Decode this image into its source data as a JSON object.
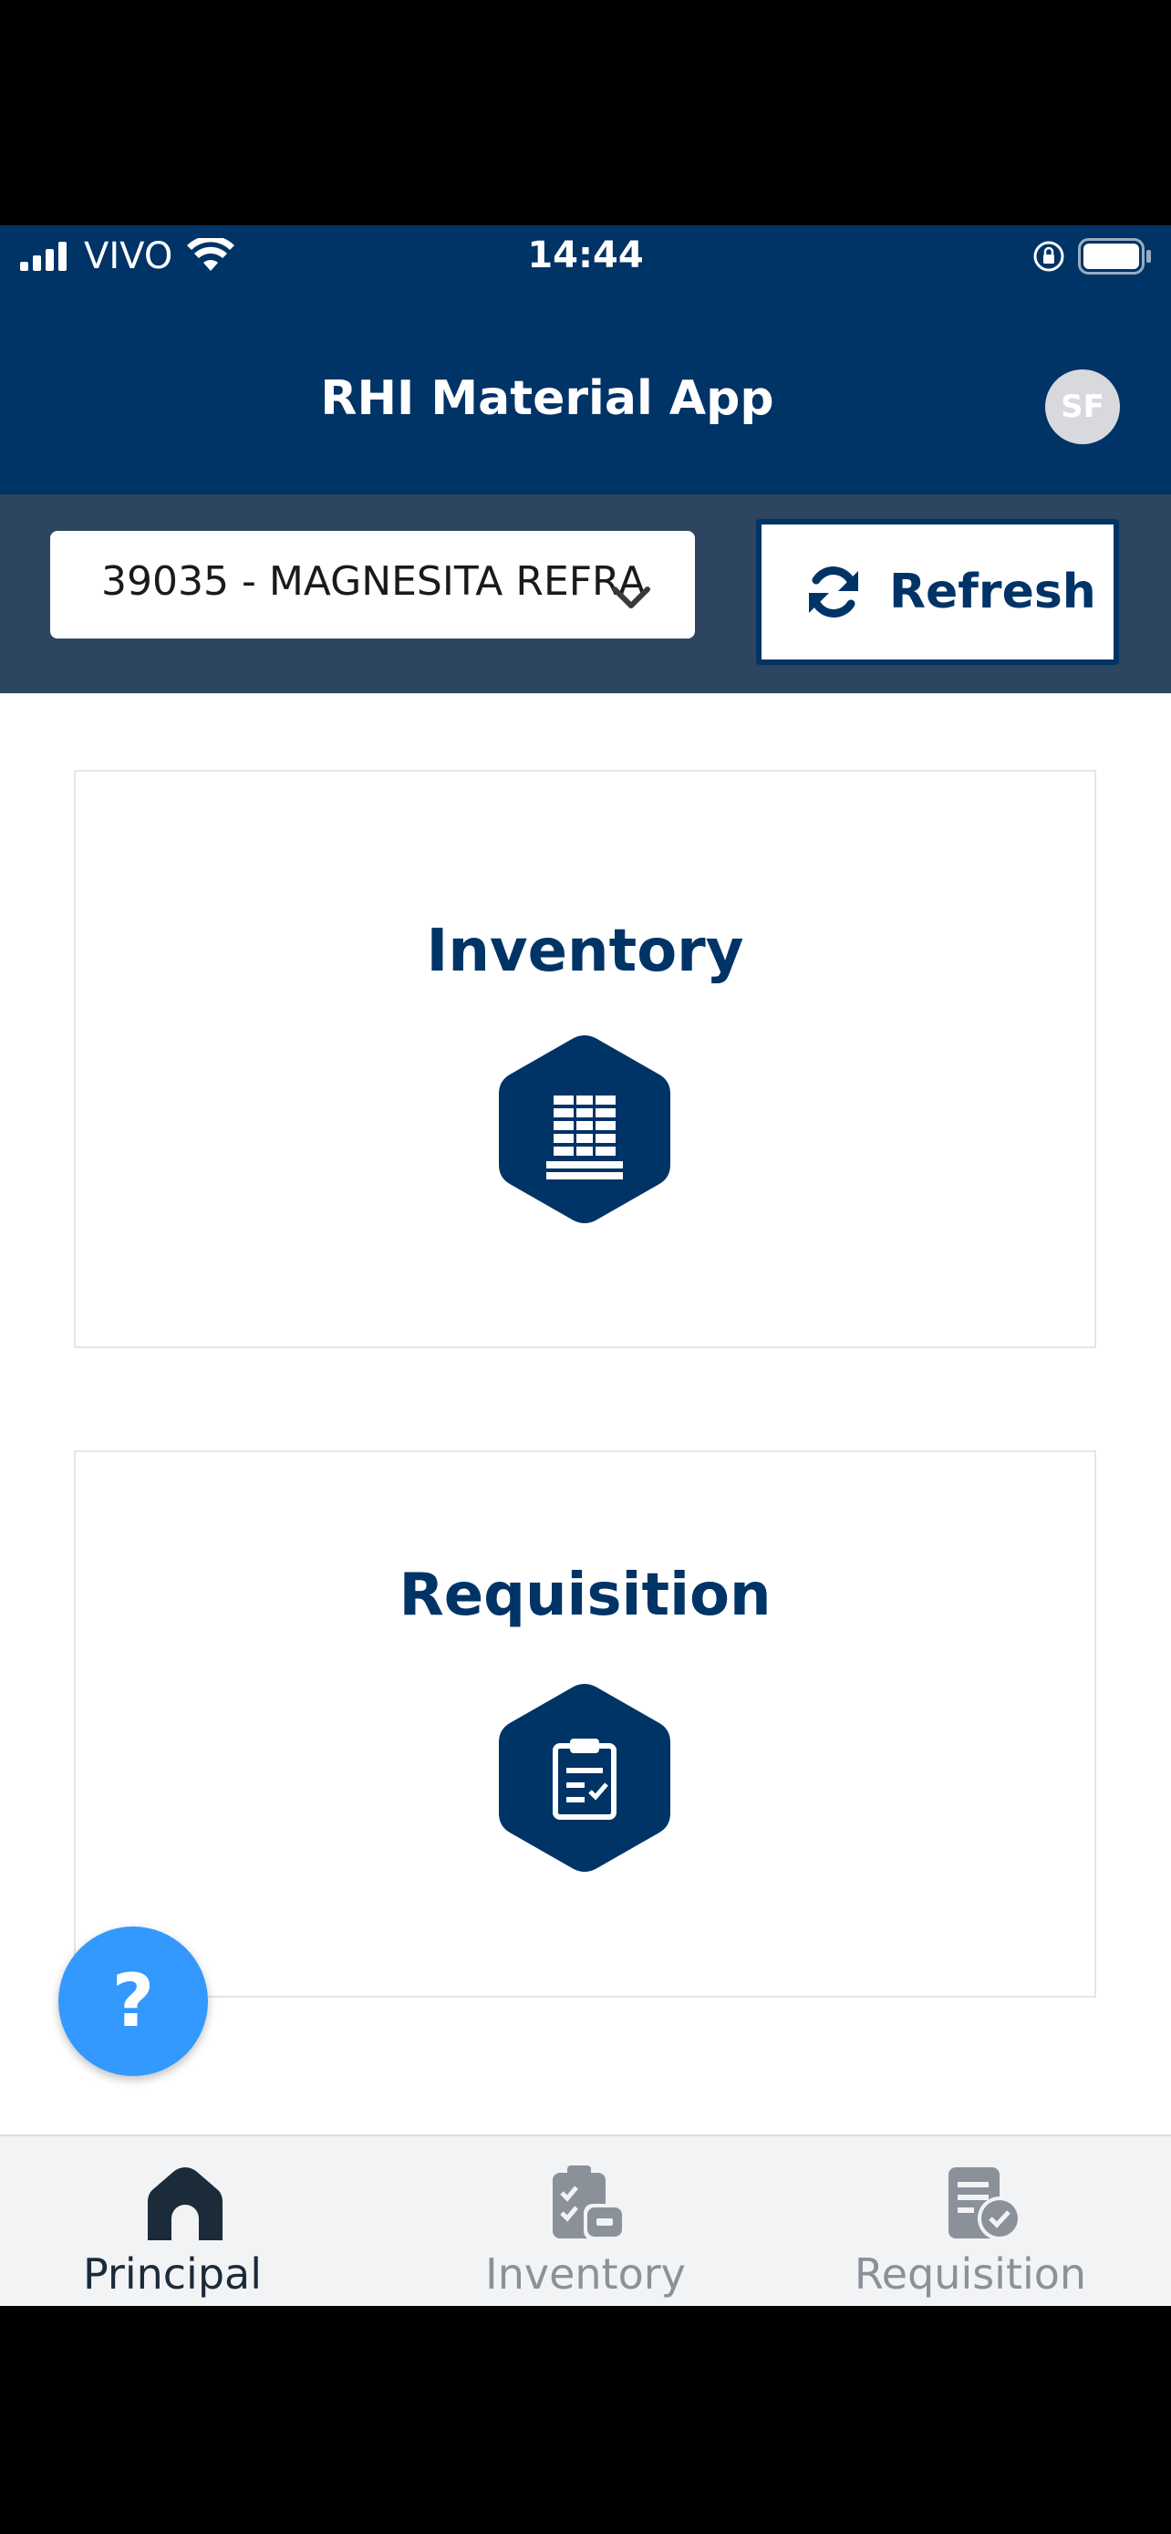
{
  "status_bar": {
    "carrier": "VIVO",
    "time": "14:44"
  },
  "header": {
    "title": "RHI Material App",
    "avatar_initials": "SF"
  },
  "toolbar": {
    "plant_select_value": "39035 - MAGNESITA REFRA",
    "refresh_label": "Refresh"
  },
  "cards": {
    "inventory_title": "Inventory",
    "requisition_title": "Requisition"
  },
  "help": {
    "label": "?"
  },
  "tabs": [
    {
      "label": "Principal",
      "icon": "home-icon",
      "active": true
    },
    {
      "label": "Inventory",
      "icon": "inventory-icon",
      "active": false
    },
    {
      "label": "Requisition",
      "icon": "requisition-icon",
      "active": false
    }
  ],
  "colors": {
    "brand": "#003366",
    "toolbar": "#2d4560",
    "help_fab": "#3399ff",
    "tab_active": "#1c2b3a",
    "tab_inactive": "#8a9199"
  }
}
